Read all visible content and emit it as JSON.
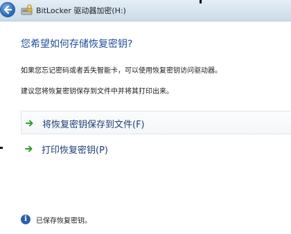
{
  "window": {
    "title": "BitLocker 驱动器加密(H:)",
    "back_icon": "back-arrow-icon",
    "app_icon": "bitlocker-icon"
  },
  "main": {
    "heading": "您希望如何存储恢复密钥?",
    "description_1": "如果您忘记密码或者丢失智能卡，可以使用恢复密钥访问驱动器。",
    "description_2": "建议您将恢复密钥保存到文件中并将其打印出来。",
    "options": [
      {
        "label": "将恢复密钥保存到文件(F)",
        "icon": "green-arrow-icon"
      },
      {
        "label": "打印恢复密钥(P)",
        "icon": "green-arrow-icon"
      }
    ]
  },
  "status": {
    "icon": "info-icon",
    "text": "已保存恢复密钥。"
  },
  "colors": {
    "heading": "#1e4fa0",
    "link": "#1d3f7a",
    "arrow": "#2e9a2e",
    "titlebar": "#d5e3ee"
  }
}
